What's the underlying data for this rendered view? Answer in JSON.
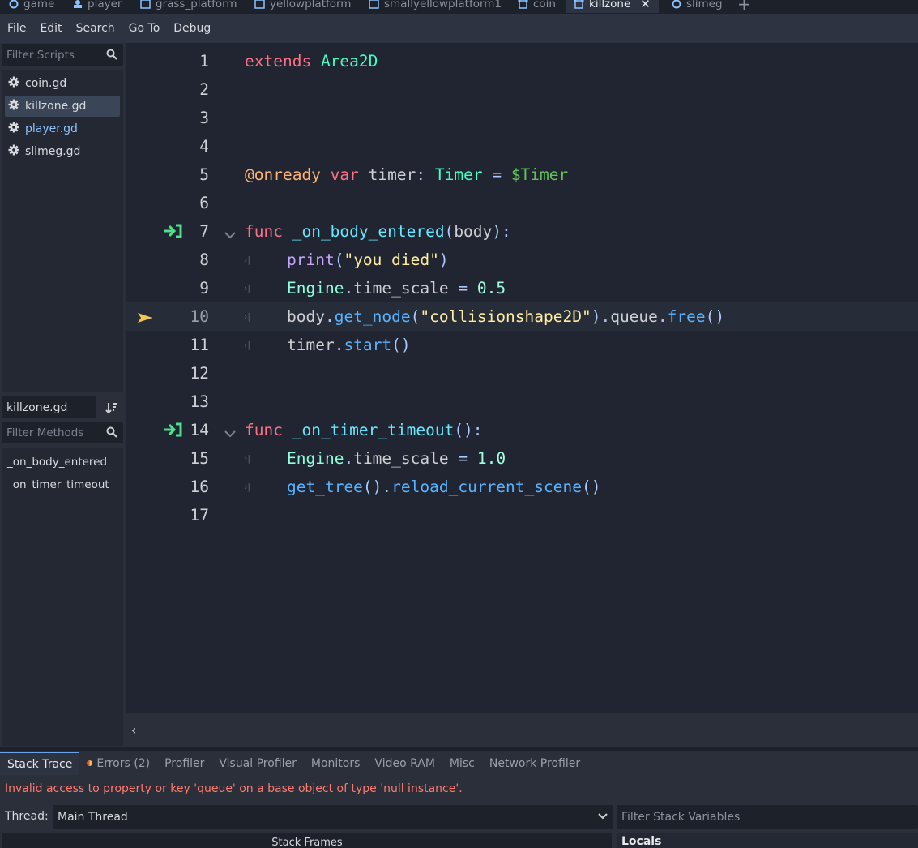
{
  "scene_tabs": [
    {
      "label": "game",
      "icon": "node2d-circle-icon"
    },
    {
      "label": "player",
      "icon": "character-icon"
    },
    {
      "label": "grass_platform",
      "icon": "static-body-icon"
    },
    {
      "label": "yellowplatform",
      "icon": "static-body-icon"
    },
    {
      "label": "smallyellowplatform1",
      "icon": "static-body-icon"
    },
    {
      "label": "coin",
      "icon": "area2d-icon"
    },
    {
      "label": "killzone",
      "icon": "area2d-icon",
      "active": true
    },
    {
      "label": "slimeg",
      "icon": "node2d-circle-icon"
    }
  ],
  "menu": {
    "file": "File",
    "edit": "Edit",
    "search": "Search",
    "goto": "Go To",
    "debug": "Debug"
  },
  "scripts_panel": {
    "filter_placeholder": "Filter Scripts",
    "scripts": [
      "coin.gd",
      "killzone.gd",
      "player.gd",
      "slimeg.gd"
    ],
    "selected": "killzone.gd",
    "current_script": "killzone.gd",
    "methods_filter_placeholder": "Filter Methods",
    "methods": [
      "_on_body_entered",
      "_on_timer_timeout"
    ]
  },
  "code_lines": [
    {
      "n": "1"
    },
    {
      "n": "2"
    },
    {
      "n": "3"
    },
    {
      "n": "4"
    },
    {
      "n": "5"
    },
    {
      "n": "6"
    },
    {
      "n": "7"
    },
    {
      "n": "8"
    },
    {
      "n": "9"
    },
    {
      "n": "10"
    },
    {
      "n": "11"
    },
    {
      "n": "12"
    },
    {
      "n": "13"
    },
    {
      "n": "14"
    },
    {
      "n": "15"
    },
    {
      "n": "16"
    },
    {
      "n": "17"
    }
  ],
  "code": {
    "l1": {
      "kw": "extends",
      "ty": "Area2D"
    },
    "l5": {
      "an": "@onready",
      "kw": "var",
      "id": "timer",
      "p1": ":",
      "ty": "Timer",
      "eq": "=",
      "np": "$Timer"
    },
    "l7": {
      "kw": "func",
      "fd": "_on_body_entered",
      "p1": "(",
      "id": "body",
      "p2": "):"
    },
    "l8": {
      "bi": "print",
      "p1": "(",
      "st": "\"you died\"",
      "p2": ")"
    },
    "l9": {
      "cl": "Engine",
      "dot": ".",
      "id": "time_scale",
      "eq": "=",
      "nm": "0.5"
    },
    "l10": {
      "id": "body",
      "d1": ".",
      "fn1": "get_node",
      "p1": "(",
      "st": "\"collisionshape2D\"",
      "p2": ").",
      "id2": "queue",
      "d2": ".",
      "fn2": "free",
      "p3": "()"
    },
    "l11": {
      "id": "timer",
      "d1": ".",
      "fn": "start",
      "p1": "()"
    },
    "l14": {
      "kw": "func",
      "fd": "_on_timer_timeout",
      "p1": "():"
    },
    "l15": {
      "cl": "Engine",
      "dot": ".",
      "id": "time_scale",
      "eq": "=",
      "nm": "1.0"
    },
    "l16": {
      "fn1": "get_tree",
      "p1": "().",
      "fn2": "reload_current_scene",
      "p2": "()"
    }
  },
  "debugger": {
    "tabs": [
      "Stack Trace",
      "Errors (2)",
      "Profiler",
      "Visual Profiler",
      "Monitors",
      "Video RAM",
      "Misc",
      "Network Profiler"
    ],
    "error_message": "Invalid access to property or key 'queue' on a base object of type 'null instance'.",
    "thread_label": "Thread:",
    "thread_value": "Main Thread",
    "filter_vars_placeholder": "Filter Stack Variables",
    "stack_frames_label": "Stack Frames",
    "locals_label": "Locals"
  },
  "colors": {
    "keyword": "#ff7085",
    "type": "#42ffc2",
    "string": "#ffeda1",
    "function": "#57b3ff",
    "error": "#ff7a6e"
  }
}
